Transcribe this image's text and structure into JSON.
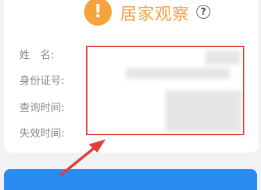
{
  "status": {
    "icon_glyph": "!",
    "title": "居家观察",
    "help_glyph": "?",
    "icon_color": "#f5a33d",
    "title_color": "#f0a24a"
  },
  "fields": [
    {
      "label": "姓　名:"
    },
    {
      "label": "身份证号:"
    },
    {
      "label": "查询时间:"
    },
    {
      "label": "失效时间:"
    }
  ],
  "annotation": {
    "box_color": "#e0403a",
    "arrow_color": "#e0403a"
  },
  "action_button": {
    "color": "#2a8cf0"
  }
}
